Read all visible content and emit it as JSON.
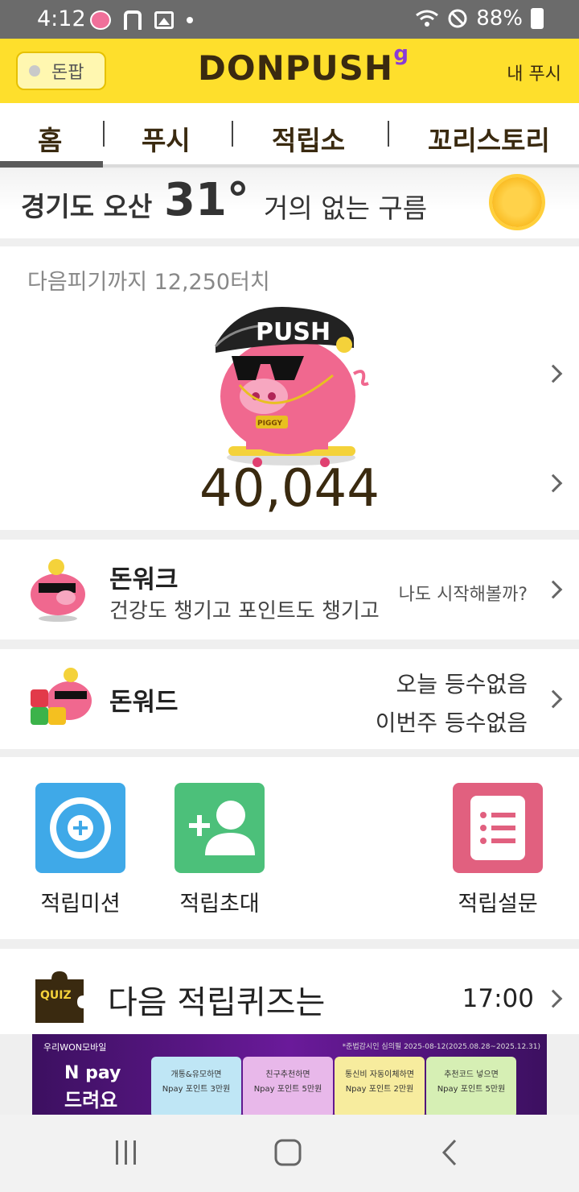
{
  "status_bar": {
    "time": "4:12",
    "battery": "88%"
  },
  "header": {
    "donpop_label": "돈팝",
    "logo": "DONPUSH",
    "logo_sup": "g",
    "my_push": "내 푸시"
  },
  "tabs": [
    {
      "label": "홈",
      "active": true
    },
    {
      "label": "푸시"
    },
    {
      "label": "적립소"
    },
    {
      "label": "꼬리스토리"
    }
  ],
  "weather": {
    "location": "경기도 오산",
    "temperature": "31°",
    "description": "거의 없는 구름"
  },
  "piggy": {
    "next_label": "다음피기까지 12,250터치",
    "points": "40,044",
    "cap_text": "PUSH",
    "chain_text": "PIGGY"
  },
  "donwalk": {
    "title": "돈워크",
    "subtitle": "건강도 챙기고 포인트도 챙기고",
    "right_text": "나도 시작해볼까?"
  },
  "donword": {
    "title": "돈워드",
    "today": "오늘 등수없음",
    "week": "이번주 등수없음"
  },
  "actions": [
    {
      "label": "적립미션",
      "color": "#3fa9e8",
      "icon": "plus-circle-icon"
    },
    {
      "label": "적립초대",
      "color": "#4cc07a",
      "icon": "add-user-icon"
    },
    {
      "label": "적립설문",
      "color": "#e1607f",
      "icon": "survey-list-icon"
    }
  ],
  "quiz": {
    "badge": "QUIZ",
    "title": "다음 적립퀴즈는",
    "time": "17:00"
  },
  "banner": {
    "brand": "우리WON모바일",
    "notice": "*준법감시인 심의필 2025-08-12(2025.08.28~2025.12.31)",
    "npay": "N pay",
    "npay_sub": "드려요",
    "cards": [
      {
        "line1": "개통&유모하면",
        "line2": "Npay 포인트 3만원",
        "color": "#bfe6f5"
      },
      {
        "line1": "친구추천하면",
        "line2": "Npay 포인트 5만원",
        "color": "#e8b8ea"
      },
      {
        "line1": "통신비 자동이체하면",
        "line2": "Npay 포인트 2만원",
        "color": "#f7ec9e"
      },
      {
        "line1": "추천코드 넣으면",
        "line2": "Npay 포인트 5만원",
        "color": "#d6efb4"
      }
    ]
  }
}
